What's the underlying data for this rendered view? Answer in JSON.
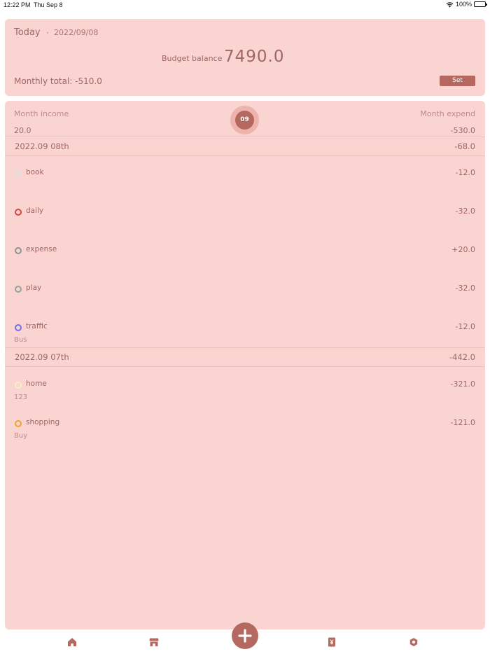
{
  "status_bar": {
    "time": "12:22 PM",
    "date": "Thu Sep 8",
    "battery": "100%"
  },
  "header": {
    "today_label": "Today",
    "separator": "·",
    "date": "2022/09/08",
    "budget_label": "Budget balance",
    "budget_value": "7490.0",
    "monthly_total": "Monthly total: -510.0",
    "set_label": "Set"
  },
  "summary": {
    "income_label": "Month income",
    "expend_label": "Month expend",
    "income_value": "20.0",
    "expend_value": "-530.0",
    "month_badge": "09"
  },
  "days": [
    {
      "date": "2022.09 08th",
      "total": "-68.0",
      "entries": [
        {
          "category": "book",
          "amount": "-12.0",
          "note": "",
          "color": "#dddddd"
        },
        {
          "category": "daily",
          "amount": "-32.0",
          "note": "",
          "color": "#d9473f"
        },
        {
          "category": "expense",
          "amount": "+20.0",
          "note": "",
          "color": "#8e9496"
        },
        {
          "category": "play",
          "amount": "-32.0",
          "note": "",
          "color": "#8ea39b"
        },
        {
          "category": "traffic",
          "amount": "-12.0",
          "note": "Bus",
          "color": "#6d6ff0"
        }
      ]
    },
    {
      "date": "2022.09 07th",
      "total": "-442.0",
      "entries": [
        {
          "category": "home",
          "amount": "-321.0",
          "note": "123",
          "color": "#f6efc8"
        },
        {
          "category": "shopping",
          "amount": "-121.0",
          "note": "Buy",
          "color": "#f0a22a"
        }
      ]
    }
  ],
  "tab_bar": {
    "icons": [
      "home-icon",
      "store-icon",
      "add-icon",
      "yuan-book-icon",
      "hexagon-settings-icon"
    ],
    "icon_color": "#b4685f"
  }
}
